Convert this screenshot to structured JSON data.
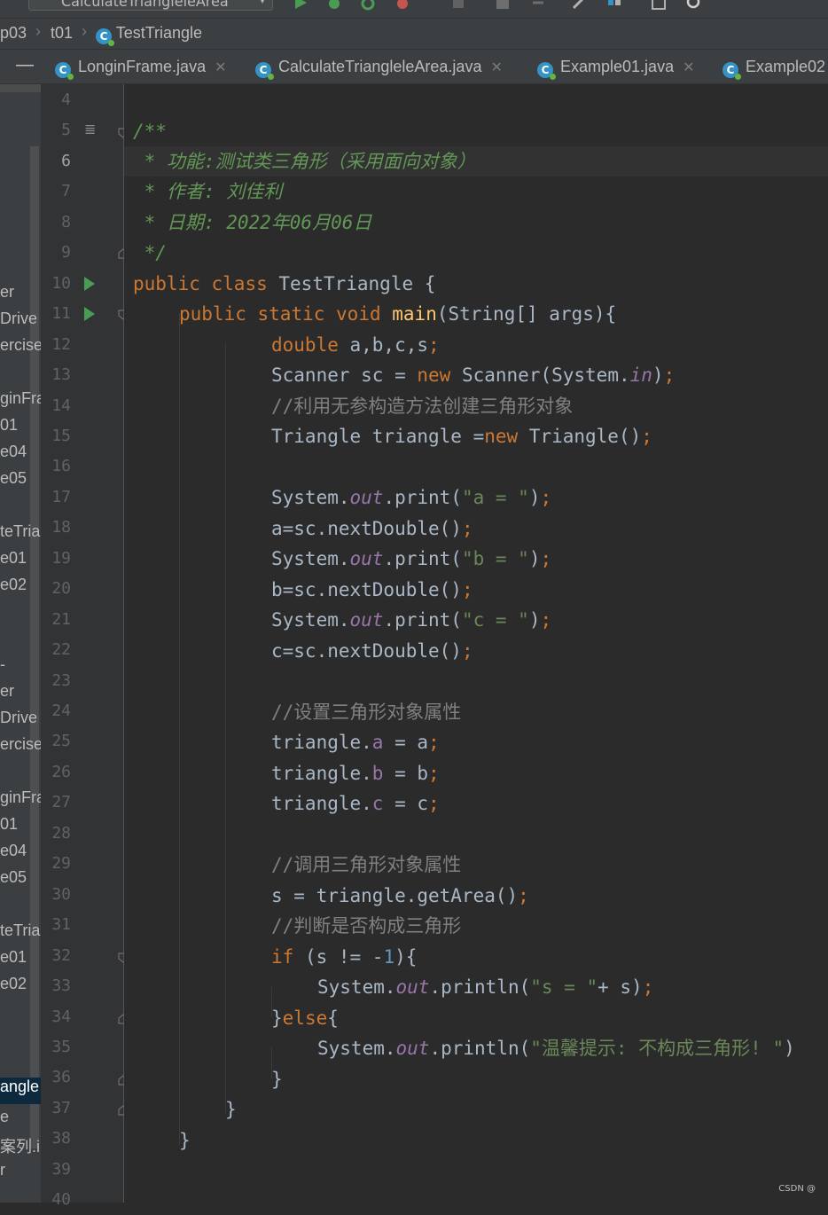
{
  "toolbar": {
    "run_config": "CalculateTriangleleArea"
  },
  "breadcrumb": {
    "items": [
      "p03",
      "t01",
      "TestTriangle"
    ]
  },
  "tabs": [
    {
      "label": "LonginFrame.java"
    },
    {
      "label": "CalculateTriangleleArea.java"
    },
    {
      "label": "Example01.java"
    },
    {
      "label": "Example02"
    }
  ],
  "project_panel": {
    "items": [
      "er",
      "Drive",
      "ercise",
      "ginFra",
      "01",
      "e04",
      "e05",
      "teTria",
      "e01",
      "e02",
      "-",
      "er",
      "Drive",
      "ercise",
      "ginFra",
      "01",
      "e04",
      "e05",
      "teTria",
      "e01",
      "e02",
      "angle",
      "e",
      "案列.im",
      "r"
    ]
  },
  "editor": {
    "current_line": 6,
    "line_numbers": [
      "4",
      "5",
      "6",
      "7",
      "8",
      "9",
      "10",
      "11",
      "12",
      "13",
      "14",
      "15",
      "16",
      "17",
      "18",
      "19",
      "20",
      "21",
      "22",
      "23",
      "24",
      "25",
      "26",
      "27",
      "28",
      "29",
      "30",
      "31",
      "32",
      "33",
      "34",
      "35",
      "36",
      "37",
      "38",
      "39",
      "40"
    ],
    "lines": {
      "l5": "/**",
      "l6": " * 功能:测试类三角形（采用面向对象）",
      "l7": " * 作者: 刘佳利",
      "l8": " * 日期: 2022年06月06日",
      "l9": " */",
      "l10": {
        "k1": "public",
        "k2": "class",
        "name": "TestTriangle {"
      },
      "l11": {
        "k1": "public",
        "k2": "static",
        "k3": "void",
        "fn": "main",
        "rest": "(String[] args){"
      },
      "l12": {
        "kw": "double",
        "rest": " a,b,c,s",
        "semi": ";"
      },
      "l13": {
        "a": "Scanner sc = ",
        "kw": "new",
        "b": " Scanner(System.",
        "sf": "in",
        "c": ")",
        "semi": ";"
      },
      "l14": "//利用无参构造方法创建三角形对象",
      "l15": {
        "a": "Triangle triangle =",
        "kw": "new",
        "b": " Triangle()",
        "semi": ";"
      },
      "l17": {
        "a": "System.",
        "sf": "out",
        "b": ".print(",
        "str": "\"a = \"",
        "c": ")",
        "semi": ";"
      },
      "l18": {
        "a": "a=sc.nextDouble()",
        "semi": ";"
      },
      "l19": {
        "a": "System.",
        "sf": "out",
        "b": ".print(",
        "str": "\"b = \"",
        "c": ")",
        "semi": ";"
      },
      "l20": {
        "a": "b=sc.nextDouble()",
        "semi": ";"
      },
      "l21": {
        "a": "System.",
        "sf": "out",
        "b": ".print(",
        "str": "\"c = \"",
        "c": ")",
        "semi": ";"
      },
      "l22": {
        "a": "c=sc.nextDouble()",
        "semi": ";"
      },
      "l24": "//设置三角形对象属性",
      "l25": {
        "a": "triangle.",
        "f": "a",
        "b": " = a",
        "semi": ";"
      },
      "l26": {
        "a": "triangle.",
        "f": "b",
        "b": " = b",
        "semi": ";"
      },
      "l27": {
        "a": "triangle.",
        "f": "c",
        "b": " = c",
        "semi": ";"
      },
      "l29": "//调用三角形对象属性",
      "l30": {
        "a": "s = triangle.getArea()",
        "semi": ";"
      },
      "l31": "//判断是否构成三角形",
      "l32": {
        "kw": "if",
        "a": " (s != -",
        "num": "1",
        "b": "){"
      },
      "l33": {
        "a": "System.",
        "sf": "out",
        "b": ".println(",
        "str": "\"s = \"",
        "c": "+ s)",
        "semi": ";"
      },
      "l34": {
        "a": "}",
        "kw": "else",
        "b": "{"
      },
      "l35": {
        "a": "System.",
        "sf": "out",
        "b": ".println(",
        "str": "\"温馨提示: 不构成三角形! \"",
        "c": ")"
      },
      "l36": "}",
      "l37": "}",
      "l38": "}"
    }
  },
  "watermark": "CSDN @",
  "colors": {
    "keyword": "#cc7832",
    "function": "#ffc66d",
    "string": "#6a8759",
    "number": "#6897bb",
    "comment": "#808080",
    "doc": "#629755",
    "field": "#9876aa"
  }
}
